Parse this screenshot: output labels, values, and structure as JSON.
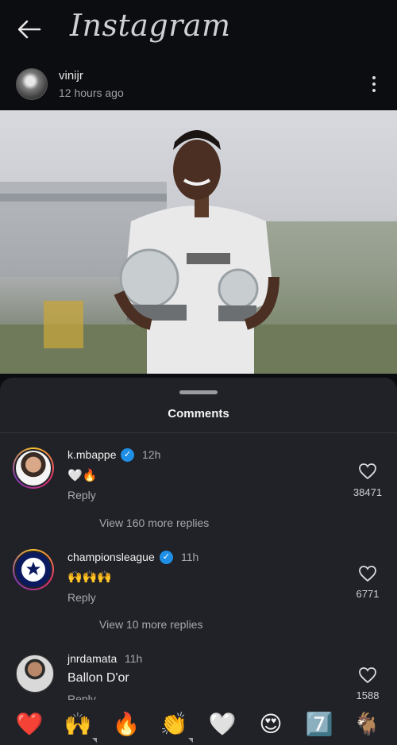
{
  "app": {
    "title": "Instagram"
  },
  "post": {
    "username": "vinijr",
    "time": "12 hours ago"
  },
  "sheet": {
    "title": "Comments"
  },
  "comments": [
    {
      "username": "k.mbappe",
      "time": "12h",
      "text": "🤍🔥",
      "reply": "Reply",
      "likes": "38471",
      "more_replies": "View 160 more replies"
    },
    {
      "username": "championsleague",
      "time": "11h",
      "text": "🙌🙌🙌",
      "reply": "Reply",
      "likes": "6771",
      "more_replies": "View 10 more replies"
    },
    {
      "username": "jnrdamata",
      "time": "11h",
      "text": "Ballon D'or",
      "reply": "Reply",
      "likes": "1588"
    }
  ],
  "emoji_bar": [
    "❤️",
    "🙌",
    "🔥",
    "👏",
    "🤍",
    "😍",
    "7️⃣",
    "🐐"
  ],
  "colors": {
    "verified": "#1f8fe6",
    "sheet_bg": "#212227",
    "app_bg": "#0c0d10"
  }
}
